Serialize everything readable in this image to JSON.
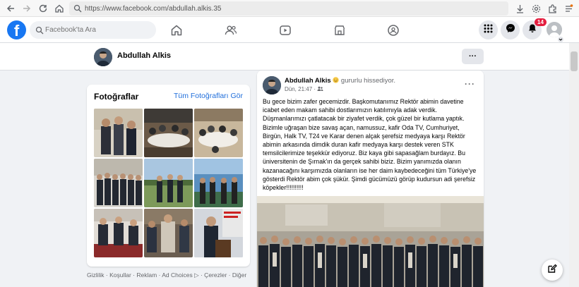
{
  "browser": {
    "url": "https://www.facebook.com/abdullah.alkis.35"
  },
  "topbar": {
    "logo": "f",
    "search_placeholder": "Facebook'ta Ara",
    "notification_count": "14"
  },
  "profile": {
    "name": "Abdullah Alkis",
    "more_label": "···"
  },
  "photos": {
    "title": "Fotoğraflar",
    "all_link": "Tüm Fotoğrafları Gör"
  },
  "footer": {
    "links": "Gizlilik · Koşullar · Reklam · Ad Choices ▷ · Çerezler · Diğer"
  },
  "post": {
    "author": "Abdullah Alkis",
    "feeling": "gururlu hissediyor.",
    "time": "Dün, 21:47 ·",
    "more": "···",
    "text": "Bu gece bizim zafer gecemizdir. Başkomutanımız Rektör abimin davetine icabet eden makam sahibi dostlarımızın katılımıyla adak verdik. Düşmanlarımızı çatlatacak bir ziyafet verdik, çok güzel bir kutlama yaptık. Bizimle uğraşan bize savaş açan, namussuz, kafir Oda TV, Cumhuriyet, Birgün, Halk TV, T24 ve Karar denen alçak şerefsiz medyaya karşı Rektör abimin arkasında dimdik duran kafir medyaya karşı destek veren STK temsilcilerimize teşekkür ediyoruz. Biz kaya gibi sapasağlam burdayız. Bu üniversitenin de Şırnak'ın da gerçek sahibi biziz. Bizim yanımızda olanın kazanacağını karşımızda olanların ise her daim kaybedeceğini tüm Türkiye'ye gösterdi Rektör abim çok şükür. Şimdi gücümüzü görüp kudursun adi şerefsiz köpekler!!!!!!!!!!"
  },
  "colors": {
    "brand": "#1877f2",
    "badge": "#e41e3f",
    "link": "#216fdb"
  }
}
